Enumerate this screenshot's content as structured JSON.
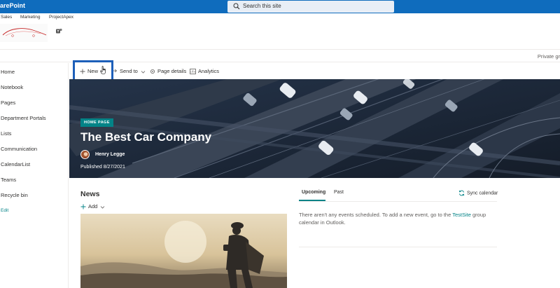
{
  "suitebar": {
    "app_name": "arePoint",
    "search_placeholder": "Search this site"
  },
  "hub_nav": [
    "Sales",
    "Marketing",
    "ProjectApex"
  ],
  "privacy_label": "Private gr",
  "left_nav": {
    "items": [
      "Home",
      "Notebook",
      "Pages",
      "Department Portals",
      "Lists",
      "Communication",
      "CalendarList",
      "Teams",
      "Recycle bin"
    ],
    "edit_label": "Edit"
  },
  "command_bar": {
    "new_label": "New",
    "send_to_label": "Send to",
    "page_details_label": "Page details",
    "analytics_label": "Analytics"
  },
  "hero": {
    "badge": "HOME PAGE",
    "title": "The Best Car Company",
    "author": "Henry Legge",
    "published": "Published 8/27/2021"
  },
  "news": {
    "title": "News",
    "add_label": "Add"
  },
  "events": {
    "tabs": [
      "Upcoming",
      "Past"
    ],
    "sync_label": "Sync calendar",
    "message_before": "There aren't any events scheduled. To add a new event, go to the ",
    "message_link": "TestSite",
    "message_after": " group calendar in Outlook."
  },
  "colors": {
    "suitebar": "#0f6cbd",
    "accent": "#038387",
    "highlight_box": "#1d5fb9"
  }
}
